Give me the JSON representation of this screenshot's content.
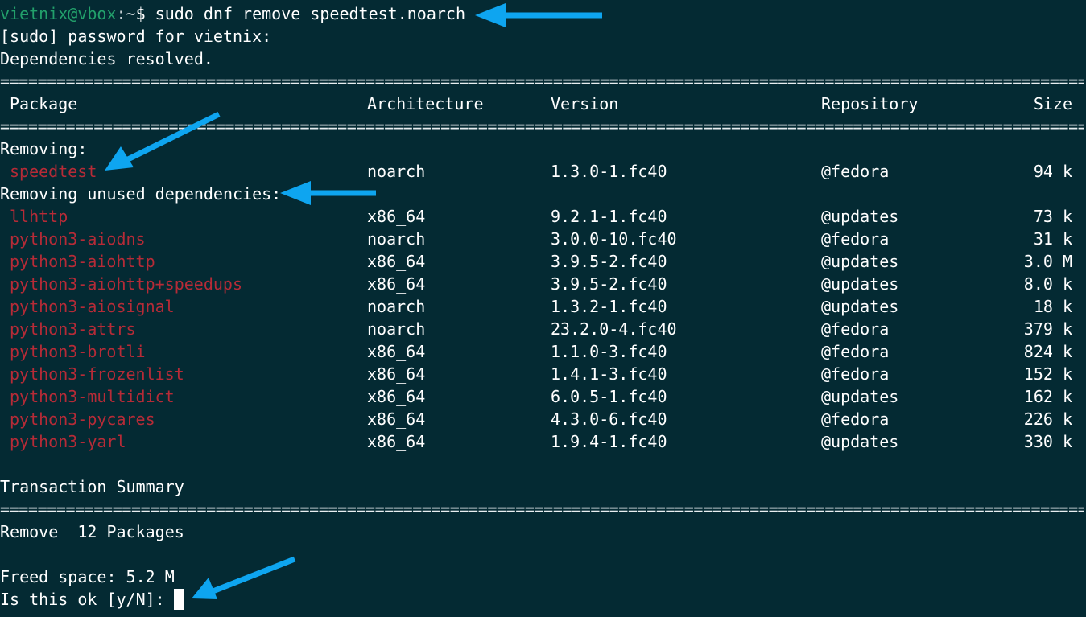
{
  "prompt": {
    "user_host": "vietnix@vbox",
    "colon": ":",
    "path": "~",
    "symbol": "$",
    "command": " sudo dnf remove speedtest.noarch"
  },
  "lines": {
    "sudo_prompt": "[sudo] password for vietnix:",
    "deps_resolved": "Dependencies resolved."
  },
  "rule_char": "=",
  "table": {
    "headers": {
      "package": "Package",
      "arch": "Architecture",
      "version": "Version",
      "repo": "Repository",
      "size": "Size"
    },
    "removing_label": "Removing:",
    "removing": [
      {
        "name": "speedtest",
        "arch": "noarch",
        "version": "1.3.0-1.fc40",
        "repo": "@fedora",
        "size": "94 k"
      }
    ],
    "unused_label": "Removing unused dependencies:",
    "unused": [
      {
        "name": "llhttp",
        "arch": "x86_64",
        "version": "9.2.1-1.fc40",
        "repo": "@updates",
        "size": "73 k"
      },
      {
        "name": "python3-aiodns",
        "arch": "noarch",
        "version": "3.0.0-10.fc40",
        "repo": "@fedora",
        "size": "31 k"
      },
      {
        "name": "python3-aiohttp",
        "arch": "x86_64",
        "version": "3.9.5-2.fc40",
        "repo": "@updates",
        "size": "3.0 M"
      },
      {
        "name": "python3-aiohttp+speedups",
        "arch": "x86_64",
        "version": "3.9.5-2.fc40",
        "repo": "@updates",
        "size": "8.0 k"
      },
      {
        "name": "python3-aiosignal",
        "arch": "noarch",
        "version": "1.3.2-1.fc40",
        "repo": "@updates",
        "size": "18 k"
      },
      {
        "name": "python3-attrs",
        "arch": "noarch",
        "version": "23.2.0-4.fc40",
        "repo": "@fedora",
        "size": "379 k"
      },
      {
        "name": "python3-brotli",
        "arch": "x86_64",
        "version": "1.1.0-3.fc40",
        "repo": "@fedora",
        "size": "824 k"
      },
      {
        "name": "python3-frozenlist",
        "arch": "x86_64",
        "version": "1.4.1-3.fc40",
        "repo": "@fedora",
        "size": "152 k"
      },
      {
        "name": "python3-multidict",
        "arch": "x86_64",
        "version": "6.0.5-1.fc40",
        "repo": "@updates",
        "size": "162 k"
      },
      {
        "name": "python3-pycares",
        "arch": "x86_64",
        "version": "4.3.0-6.fc40",
        "repo": "@fedora",
        "size": "226 k"
      },
      {
        "name": "python3-yarl",
        "arch": "x86_64",
        "version": "1.9.4-1.fc40",
        "repo": "@updates",
        "size": "330 k"
      }
    ]
  },
  "summary": {
    "title": "Transaction Summary",
    "remove_line": "Remove  12 Packages",
    "freed_space": "Freed space: 5.2 M",
    "confirm_prompt": "Is this ok [y/N]: "
  },
  "colors": {
    "background": "#042a33",
    "prompt_green": "#22a06b",
    "package_red": "#b62b37",
    "arrow_blue": "#0ea5f0"
  },
  "icons": {
    "annotation": "arrow-icon"
  }
}
